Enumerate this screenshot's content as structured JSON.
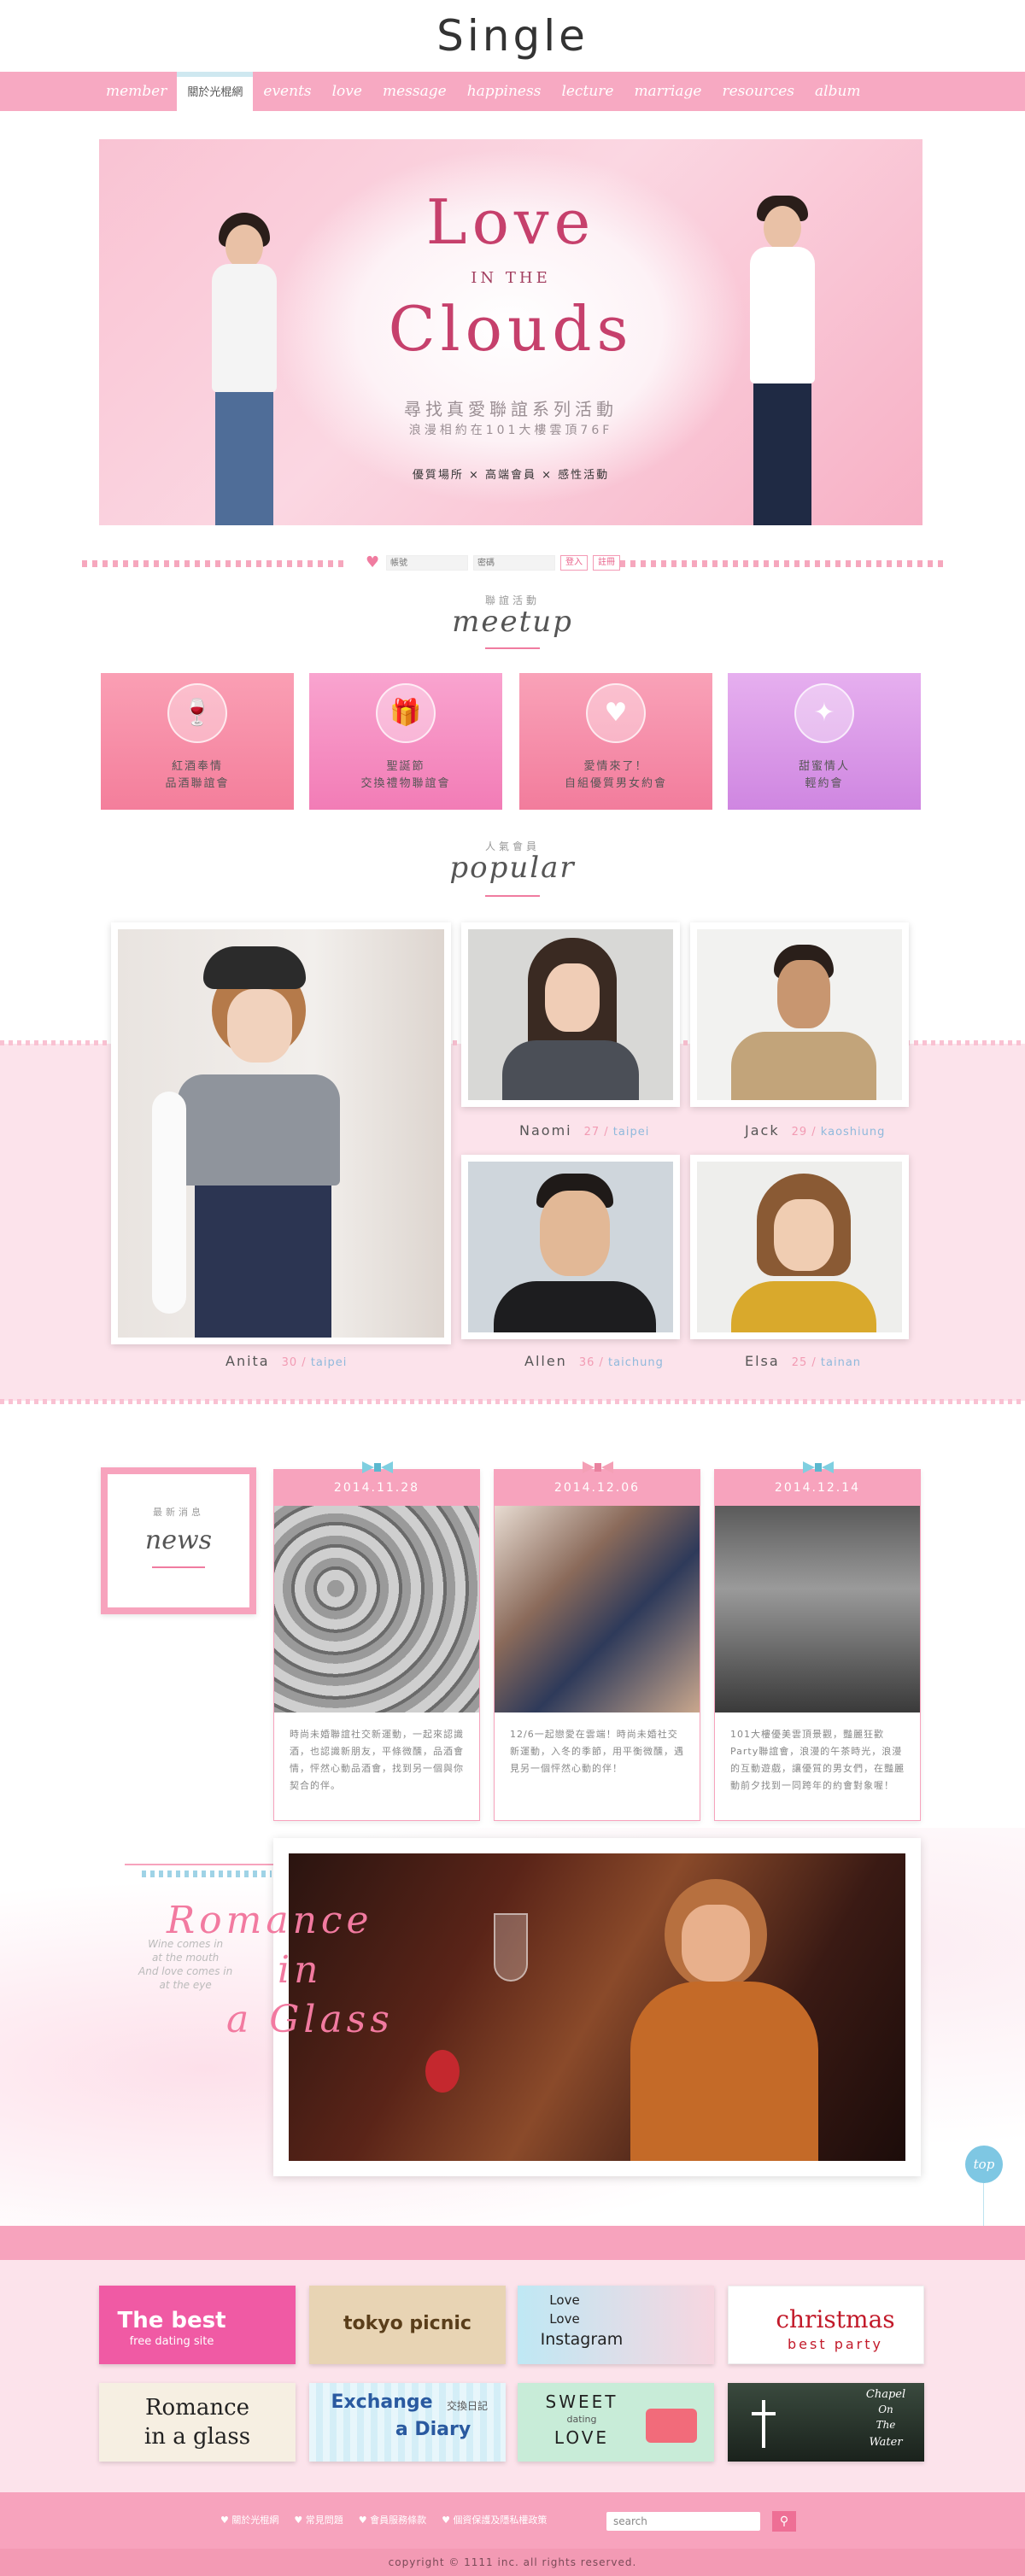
{
  "site": {
    "logo": "Single"
  },
  "nav": {
    "items": [
      "member",
      "關於光棍網",
      "events",
      "love",
      "message",
      "happiness",
      "lecture",
      "marriage",
      "resources",
      "album"
    ],
    "active_index": 1
  },
  "hero": {
    "title_1": "Love",
    "title_2": "IN THE",
    "title_3": "Clouds",
    "sub_1": "尋找真愛聯誼系列活動",
    "sub_2": "浪漫相約在101大樓雲頂76F",
    "tags": "優質場所 × 高端會員 × 感性活動"
  },
  "login": {
    "user_placeholder": "帳號",
    "pass_placeholder": "密碼",
    "login_label": "登入",
    "register_label": "註冊"
  },
  "meetup": {
    "small": "聯誼活動",
    "big": "meetup",
    "cards": [
      {
        "line1": "紅酒奉情",
        "line2": "品酒聯誼會",
        "icon": "wine-glasses-icon",
        "color": "#f6899f"
      },
      {
        "line1": "聖誕節",
        "line2": "交換禮物聯誼會",
        "icon": "gift-icon",
        "color": "#f78fc0"
      },
      {
        "line1": "愛情來了！",
        "line2": "自組優質男女約會",
        "icon": "hearts-icon",
        "color": "#f58eaa"
      },
      {
        "line1": "甜蜜情人",
        "line2": "輕約會",
        "icon": "masquerade-mask-icon",
        "color": "#d99ee6"
      }
    ]
  },
  "popular": {
    "small": "人氣會員",
    "big": "popular",
    "members": [
      {
        "name": "Anita",
        "age": "30",
        "loc": "taipei"
      },
      {
        "name": "Naomi",
        "age": "27",
        "loc": "taipei"
      },
      {
        "name": "Jack",
        "age": "29",
        "loc": "kaoshiung"
      },
      {
        "name": "Allen",
        "age": "36",
        "loc": "taichung"
      },
      {
        "name": "Elsa",
        "age": "25",
        "loc": "tainan"
      }
    ],
    "sep": " / "
  },
  "news": {
    "small": "最新消息",
    "big": "news",
    "items": [
      {
        "date": "2014.11.28",
        "text": "時尚未婚聯誼社交新運動，一起來認識酒，也認識新朋友，平條微醺，品酒會情，怦然心動品酒會，找到另一個與你契合的伴。"
      },
      {
        "date": "2014.12.06",
        "text": "12/6一起戀愛在雲端！時尚未婚社交新運動，入冬的季節，用平衡微醺，遇見另一個怦然心動的伴！"
      },
      {
        "date": "2014.12.14",
        "text": "101大樓優美雲頂景觀，豔麗狂歡Party聯誼會，浪漫的午茶時光，浪漫的互動遊戲，讓優質的男女們，在豔麗動前夕找到一同跨年的約會對象喔！"
      }
    ]
  },
  "romance": {
    "line1": "Romance",
    "line2": "in",
    "line3": "a Glass",
    "poem": [
      "Wine comes in",
      "at the mouth",
      "And love comes in",
      "at the eye"
    ]
  },
  "top_label": "top",
  "banners": [
    {
      "l1": "The best",
      "l2": "free dating site"
    },
    {
      "l1": "tokyo picnic",
      "l2": ""
    },
    {
      "l1": "Love",
      "l2": "Love",
      "l3": "Instagram"
    },
    {
      "l1": "christmas",
      "l2": "best party"
    },
    {
      "l1": "Romance",
      "l2": "in a glass"
    },
    {
      "l1": "Exchange",
      "l2": "交換日記",
      "l3": "a Diary"
    },
    {
      "l1": "SWEET",
      "l2": "dating",
      "l3": "LOVE"
    },
    {
      "l1": "Chapel",
      "l2": "On",
      "l3": "The",
      "l4": "Water"
    }
  ],
  "footer": {
    "links": [
      "關於光棍網",
      "常見問題",
      "會員服務條款",
      "個資保護及隱私權政策"
    ],
    "search_placeholder": "search",
    "copyright": "copyright © 1111 inc. all rights reserved."
  }
}
